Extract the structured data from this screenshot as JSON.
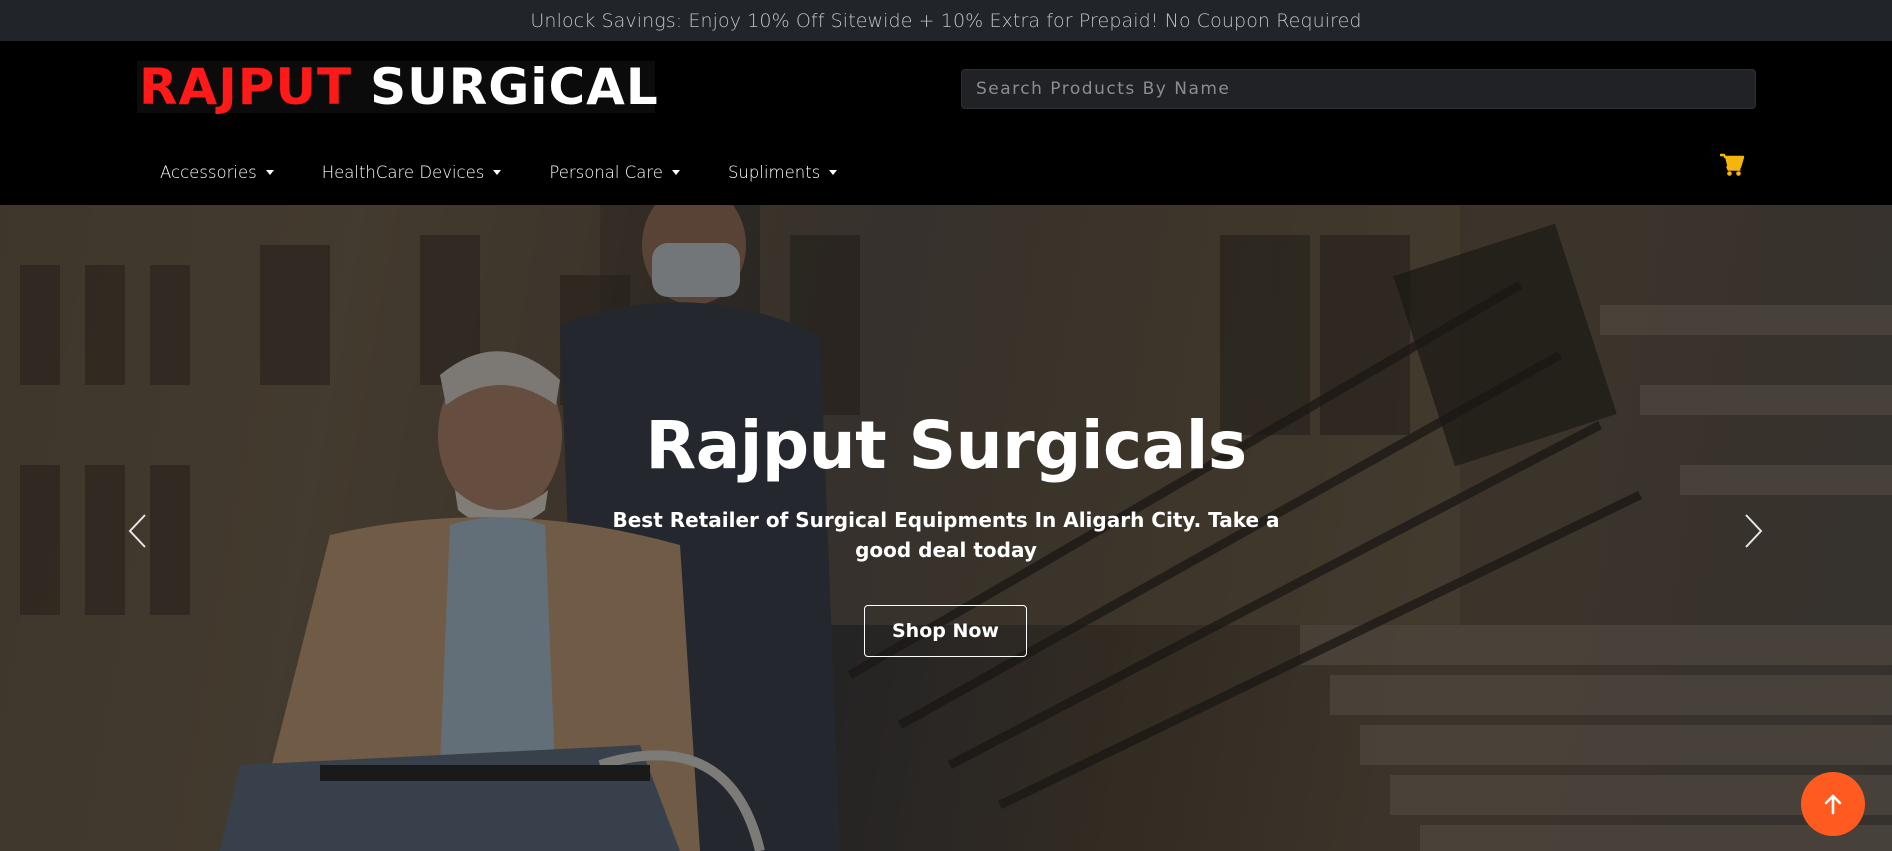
{
  "announcement": "Unlock Savings: Enjoy 10% Off Sitewide + 10% Extra for Prepaid! No Coupon Required",
  "logo": {
    "part1": "RAJPUT",
    "part2": "SURGiCAL"
  },
  "search": {
    "placeholder": "Search Products By Name",
    "value": ""
  },
  "nav": {
    "items": [
      {
        "label": "Accessories"
      },
      {
        "label": "HealthCare Devices"
      },
      {
        "label": "Personal Care"
      },
      {
        "label": "Supliments"
      }
    ]
  },
  "hero": {
    "title": "Rajput Surgicals",
    "subtitle": "Best Retailer of Surgical Equipments In Aligarh City. Take a good deal today",
    "button": "Shop Now"
  },
  "colors": {
    "announcement_bg": "#212529",
    "header_bg": "#000000",
    "logo_red": "#ff1a1a",
    "cart_icon": "#f5b60b",
    "scroll_top_button": "#ff5a1f"
  },
  "icons": [
    "cart-icon",
    "caret-down-icon",
    "chevron-left-icon",
    "chevron-right-icon",
    "arrow-up-icon"
  ]
}
